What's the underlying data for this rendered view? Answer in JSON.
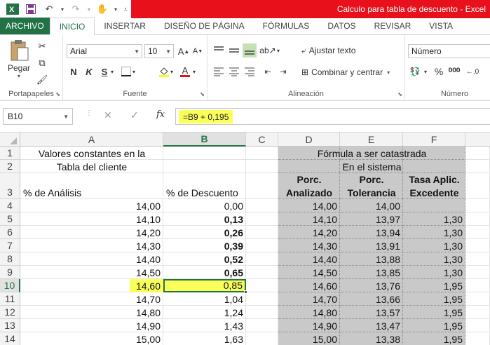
{
  "title_bar": {
    "title": "Calculo para tabla de descuento -  Excel"
  },
  "tabs": [
    "ARCHIVO",
    "INICIO",
    "INSERTAR",
    "DISEÑO DE PÁGINA",
    "FÓRMULAS",
    "DATOS",
    "REVISAR",
    "VISTA"
  ],
  "ribbon": {
    "clipboard": {
      "paste_label": "Pegar",
      "group_label": "Portapapeles"
    },
    "font": {
      "font_name": "Arial",
      "font_size": "10",
      "bold": "N",
      "italic": "K",
      "underline": "S",
      "group_label": "Fuente"
    },
    "alignment": {
      "wrap_text": "Ajustar texto",
      "merge_center": "Combinar y centrar",
      "group_label": "Alineación"
    },
    "number": {
      "format": "Número",
      "percent": "%",
      "group_label": "Número"
    }
  },
  "formula_bar": {
    "name_box": "B10",
    "formula": "=B9 + 0,195",
    "cancel": "✕",
    "enter": "✓",
    "fx": "fx"
  },
  "columns": [
    "A",
    "B",
    "C",
    "D",
    "E",
    "F"
  ],
  "rows": [
    "1",
    "2",
    "3",
    "4",
    "5",
    "6",
    "7",
    "8",
    "9",
    "10",
    "11",
    "12",
    "13",
    "14"
  ],
  "sheet": {
    "a1": "Valores constantes en la",
    "a2": "Tabla del cliente",
    "d1": "Fórmula a ser catastrada",
    "d2": "En el sistema",
    "a3": "% de Análisis",
    "b3": "% de Descuento",
    "d3": "Porc. Analizado",
    "e3": "Porc. Tolerancia",
    "f3": "Tasa Aplic. Excedente",
    "data": [
      {
        "a": "14,00",
        "b": "0,00",
        "b_bold": false,
        "d": "14,00",
        "e": "14,00",
        "f": ""
      },
      {
        "a": "14,10",
        "b": "0,13",
        "b_bold": true,
        "d": "14,10",
        "e": "13,97",
        "f": "1,30"
      },
      {
        "a": "14,20",
        "b": "0,26",
        "b_bold": true,
        "d": "14,20",
        "e": "13,94",
        "f": "1,30"
      },
      {
        "a": "14,30",
        "b": "0,39",
        "b_bold": true,
        "d": "14,30",
        "e": "13,91",
        "f": "1,30"
      },
      {
        "a": "14,40",
        "b": "0,52",
        "b_bold": true,
        "d": "14,40",
        "e": "13,88",
        "f": "1,30"
      },
      {
        "a": "14,50",
        "b": "0,65",
        "b_bold": true,
        "d": "14,50",
        "e": "13,85",
        "f": "1,30"
      },
      {
        "a": "14,60",
        "b": "0,85",
        "b_bold": false,
        "d": "14,60",
        "e": "13,76",
        "f": "1,95"
      },
      {
        "a": "14,70",
        "b": "1,04",
        "b_bold": false,
        "d": "14,70",
        "e": "13,66",
        "f": "1,95"
      },
      {
        "a": "14,80",
        "b": "1,24",
        "b_bold": false,
        "d": "14,80",
        "e": "13,57",
        "f": "1,95"
      },
      {
        "a": "14,90",
        "b": "1,43",
        "b_bold": false,
        "d": "14,90",
        "e": "13,47",
        "f": "1,95"
      },
      {
        "a": "15,00",
        "b": "1,63",
        "b_bold": false,
        "d": "15,00",
        "e": "13,38",
        "f": "1,95"
      }
    ]
  },
  "colors": {
    "excel_green": "#217346",
    "title_red": "#e8101b",
    "highlight_yellow": "#fbff5a",
    "gray_fill": "#c9c9c9"
  }
}
